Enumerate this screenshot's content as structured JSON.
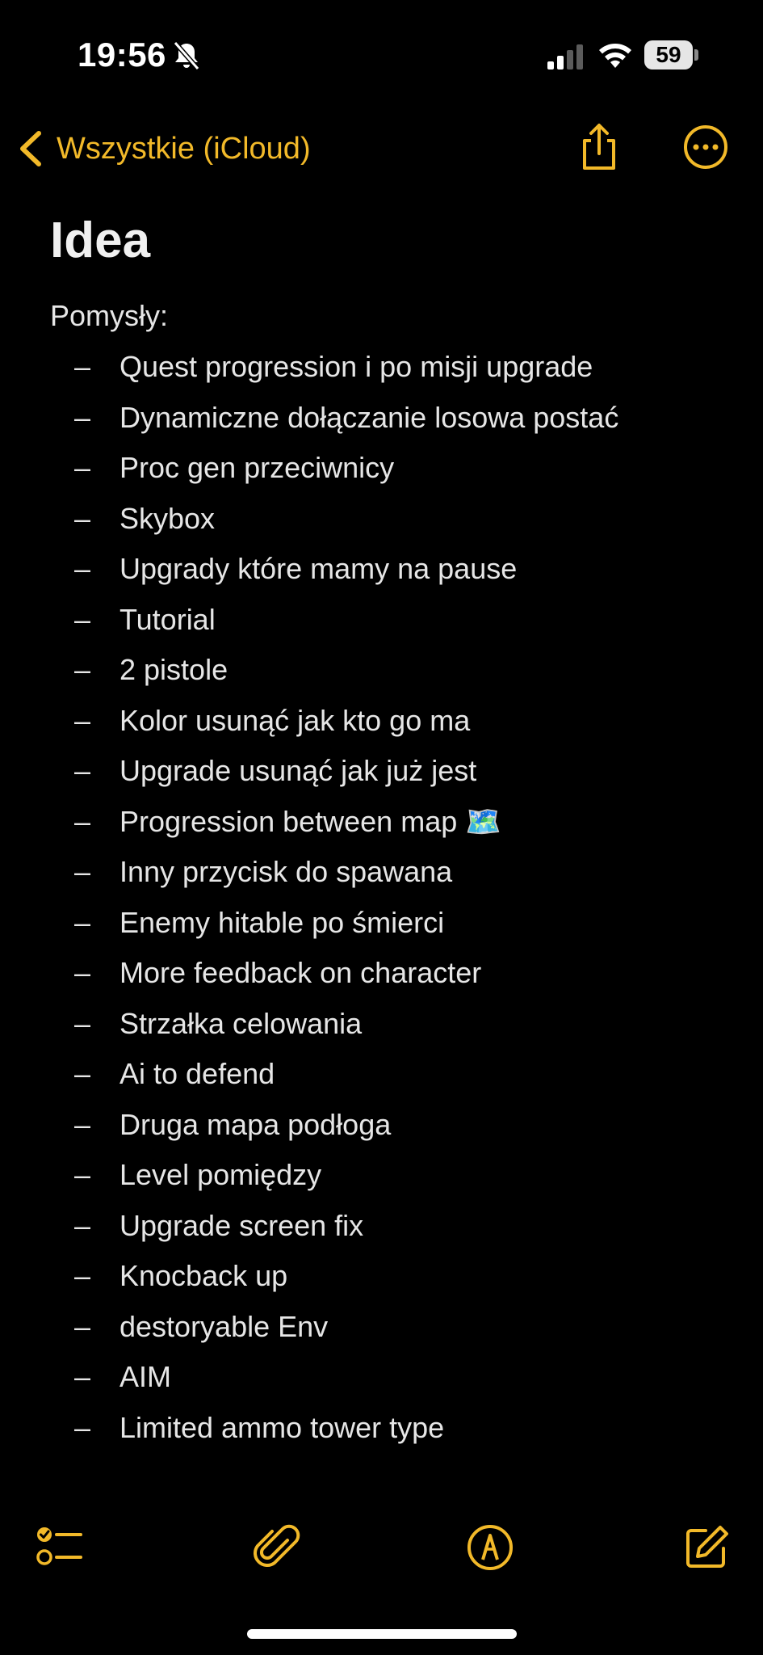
{
  "status_bar": {
    "time": "19:56",
    "battery": "59",
    "icons": [
      "bell-slash-icon",
      "cellular-signal-icon",
      "wifi-icon",
      "battery-icon"
    ]
  },
  "nav": {
    "back_label": "Wszystkie (iCloud)",
    "icons": [
      "chevron-left-icon",
      "share-icon",
      "more-icon"
    ],
    "accent_color": "#f2b929"
  },
  "note": {
    "title": "Idea",
    "heading": "Pomysły:",
    "bullet": "–",
    "items": [
      "Quest progression i po misji upgrade",
      "Dynamiczne dołączanie losowa postać",
      "Proc gen przeciwnicy",
      "Skybox",
      "Upgrady które mamy na pause",
      "Tutorial",
      "2 pistole",
      "Kolor usunąć jak kto go ma",
      "Upgrade usunąć jak już jest",
      "Progression between map 🗺️",
      "Inny przycisk do spawana",
      "Enemy hitable po śmierci",
      "More feedback on character",
      "Strzałka celowania",
      "Ai to defend",
      "Druga mapa podłoga",
      "Level pomiędzy",
      "Upgrade screen fix",
      "Knocback up",
      "destoryable Env",
      "AIM",
      "Limited ammo tower type"
    ]
  },
  "toolbar": {
    "icons": [
      "checklist-icon",
      "paperclip-icon",
      "markup-pen-icon",
      "compose-icon"
    ]
  }
}
